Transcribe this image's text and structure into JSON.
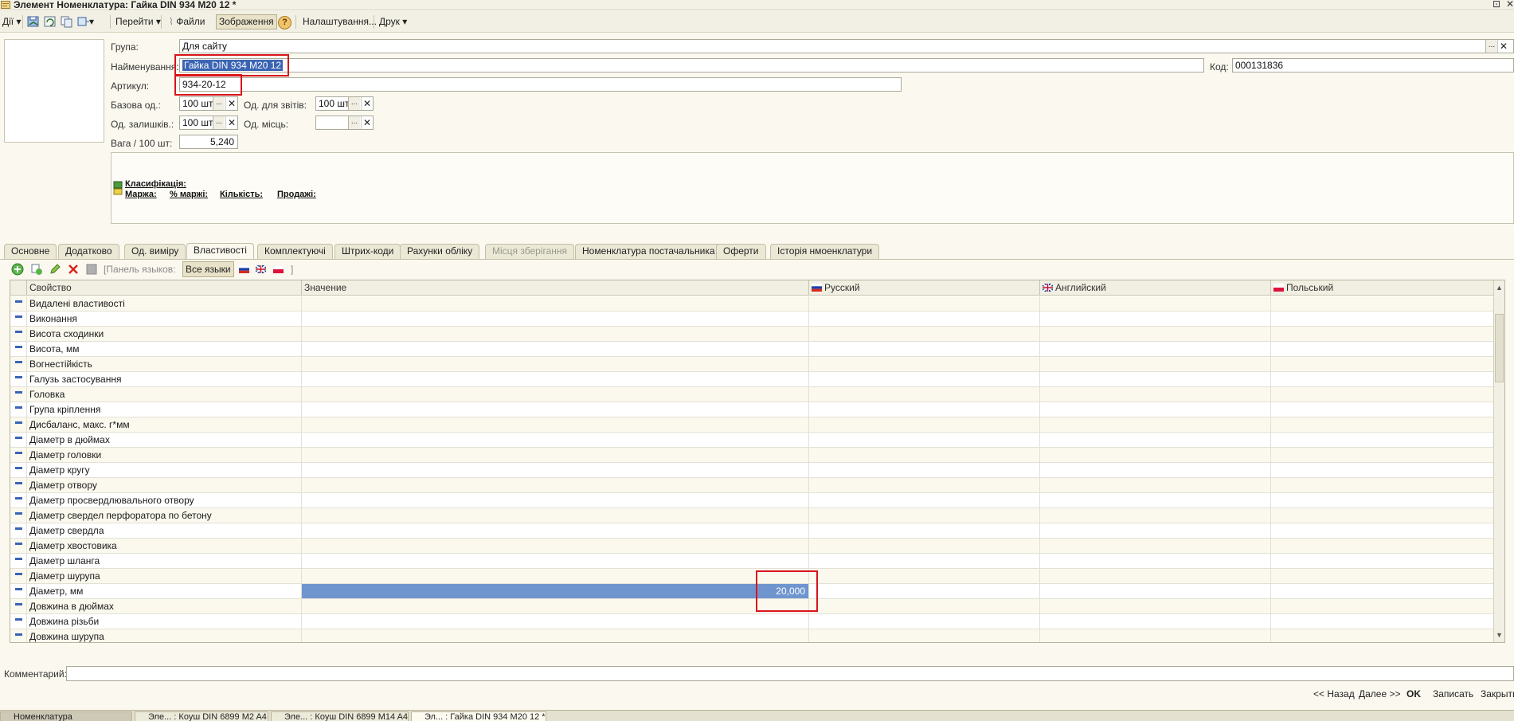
{
  "window": {
    "title": "Элемент Номенклатура: Гайка DIN 934 M20 12 *",
    "icon": "document-icon",
    "controls": [
      "⊡",
      "✕"
    ]
  },
  "toolbar": {
    "actions_label": "Дії",
    "goto_label": "Перейти",
    "files_label": "Файли",
    "images_label": "Зображення",
    "help_label": "?",
    "settings_label": "Налаштування...",
    "print_label": "Друк"
  },
  "form": {
    "group": {
      "label": "Група:",
      "value": "Для сайту"
    },
    "name": {
      "label": "Найменування:",
      "value": "Гайка DIN 934 M20 12"
    },
    "code": {
      "label": "Код:",
      "value": "000131836"
    },
    "article": {
      "label": "Артикул:",
      "value": "934-20-12"
    },
    "base_unit": {
      "label": "Базова од.:",
      "value": "100 шт"
    },
    "report_unit": {
      "label": "Од. для звітів:",
      "value": "100 шт"
    },
    "stock_unit": {
      "label": "Од. залишків.:",
      "value": "100 шт"
    },
    "place_unit": {
      "label": "Од. місць:",
      "value": ""
    },
    "weight": {
      "label": "Вага / 100 шт:",
      "value": "5,240"
    }
  },
  "info": {
    "classification": "Класифікація:",
    "margin": "Маржа:",
    "margin_pct": "% маржі:",
    "quantity": "Кількість:",
    "sales": "Продажі:"
  },
  "tabs": [
    {
      "label": "Основне",
      "active": false,
      "disabled": false
    },
    {
      "label": "Додатково",
      "active": false,
      "disabled": false
    },
    {
      "label": "Од. виміру",
      "active": false,
      "disabled": false
    },
    {
      "label": "Властивості",
      "active": true,
      "disabled": false
    },
    {
      "label": "Комплектуючі",
      "active": false,
      "disabled": false
    },
    {
      "label": "Штрих-коди",
      "active": false,
      "disabled": false
    },
    {
      "label": "Рахунки обліку",
      "active": false,
      "disabled": false
    },
    {
      "label": "Місця зберігання",
      "active": false,
      "disabled": true
    },
    {
      "label": "Номенклатура постачальника",
      "active": false,
      "disabled": false
    },
    {
      "label": "Оферти",
      "active": false,
      "disabled": false
    },
    {
      "label": "Історія нмоенклатури",
      "active": false,
      "disabled": false
    }
  ],
  "subtoolbar": {
    "lang_panel_label": "[Панель языков:",
    "all_langs_label": "Все языки",
    "close_bracket": "]"
  },
  "grid": {
    "columns": [
      "Свойство",
      "Значение",
      "Русский",
      "Английский",
      "Польський"
    ],
    "rows": [
      {
        "property": "Видалені властивості",
        "value": ""
      },
      {
        "property": "Виконання",
        "value": ""
      },
      {
        "property": "Висота сходинки",
        "value": ""
      },
      {
        "property": "Висота, мм",
        "value": ""
      },
      {
        "property": "Вогнестійкість",
        "value": ""
      },
      {
        "property": "Галузь застосування",
        "value": ""
      },
      {
        "property": "Головка",
        "value": ""
      },
      {
        "property": "Група кріплення",
        "value": ""
      },
      {
        "property": "Дисбаланс, макс. г*мм",
        "value": ""
      },
      {
        "property": "Діаметр в дюймах",
        "value": ""
      },
      {
        "property": "Діаметр головки",
        "value": ""
      },
      {
        "property": "Діаметр кругу",
        "value": ""
      },
      {
        "property": "Діаметр отвору",
        "value": ""
      },
      {
        "property": "Діаметр просвердлювального отвору",
        "value": ""
      },
      {
        "property": "Діаметр свердел перфоратора по бетону",
        "value": ""
      },
      {
        "property": "Діаметр свердла",
        "value": ""
      },
      {
        "property": "Діаметр хвостовика",
        "value": ""
      },
      {
        "property": "Діаметр шланга",
        "value": ""
      },
      {
        "property": "Діаметр шурупа",
        "value": ""
      },
      {
        "property": "Діаметр, мм",
        "value": "20,000"
      },
      {
        "property": "Довжина в дюймах",
        "value": ""
      },
      {
        "property": "Довжина різьби",
        "value": ""
      },
      {
        "property": "Довжина шурупа",
        "value": ""
      }
    ]
  },
  "comment": {
    "label": "Комментарий:",
    "value": ""
  },
  "footer": {
    "back": "<< Назад",
    "next": "Далее >>",
    "ok": "OK",
    "save": "Записать",
    "close": "Закрыть"
  },
  "taskbar": [
    "Номенклатура",
    "Эле... : Коуш DIN 6899 M2 A4",
    "Эле... : Коуш DIN 6899 M14 A4",
    "Эл... : Гайка DIN 934 M20 12 *"
  ],
  "colors": {
    "selection": "#3b64b3",
    "selected_cell": "#6f95cf",
    "highlight_box": "#d9141b"
  }
}
